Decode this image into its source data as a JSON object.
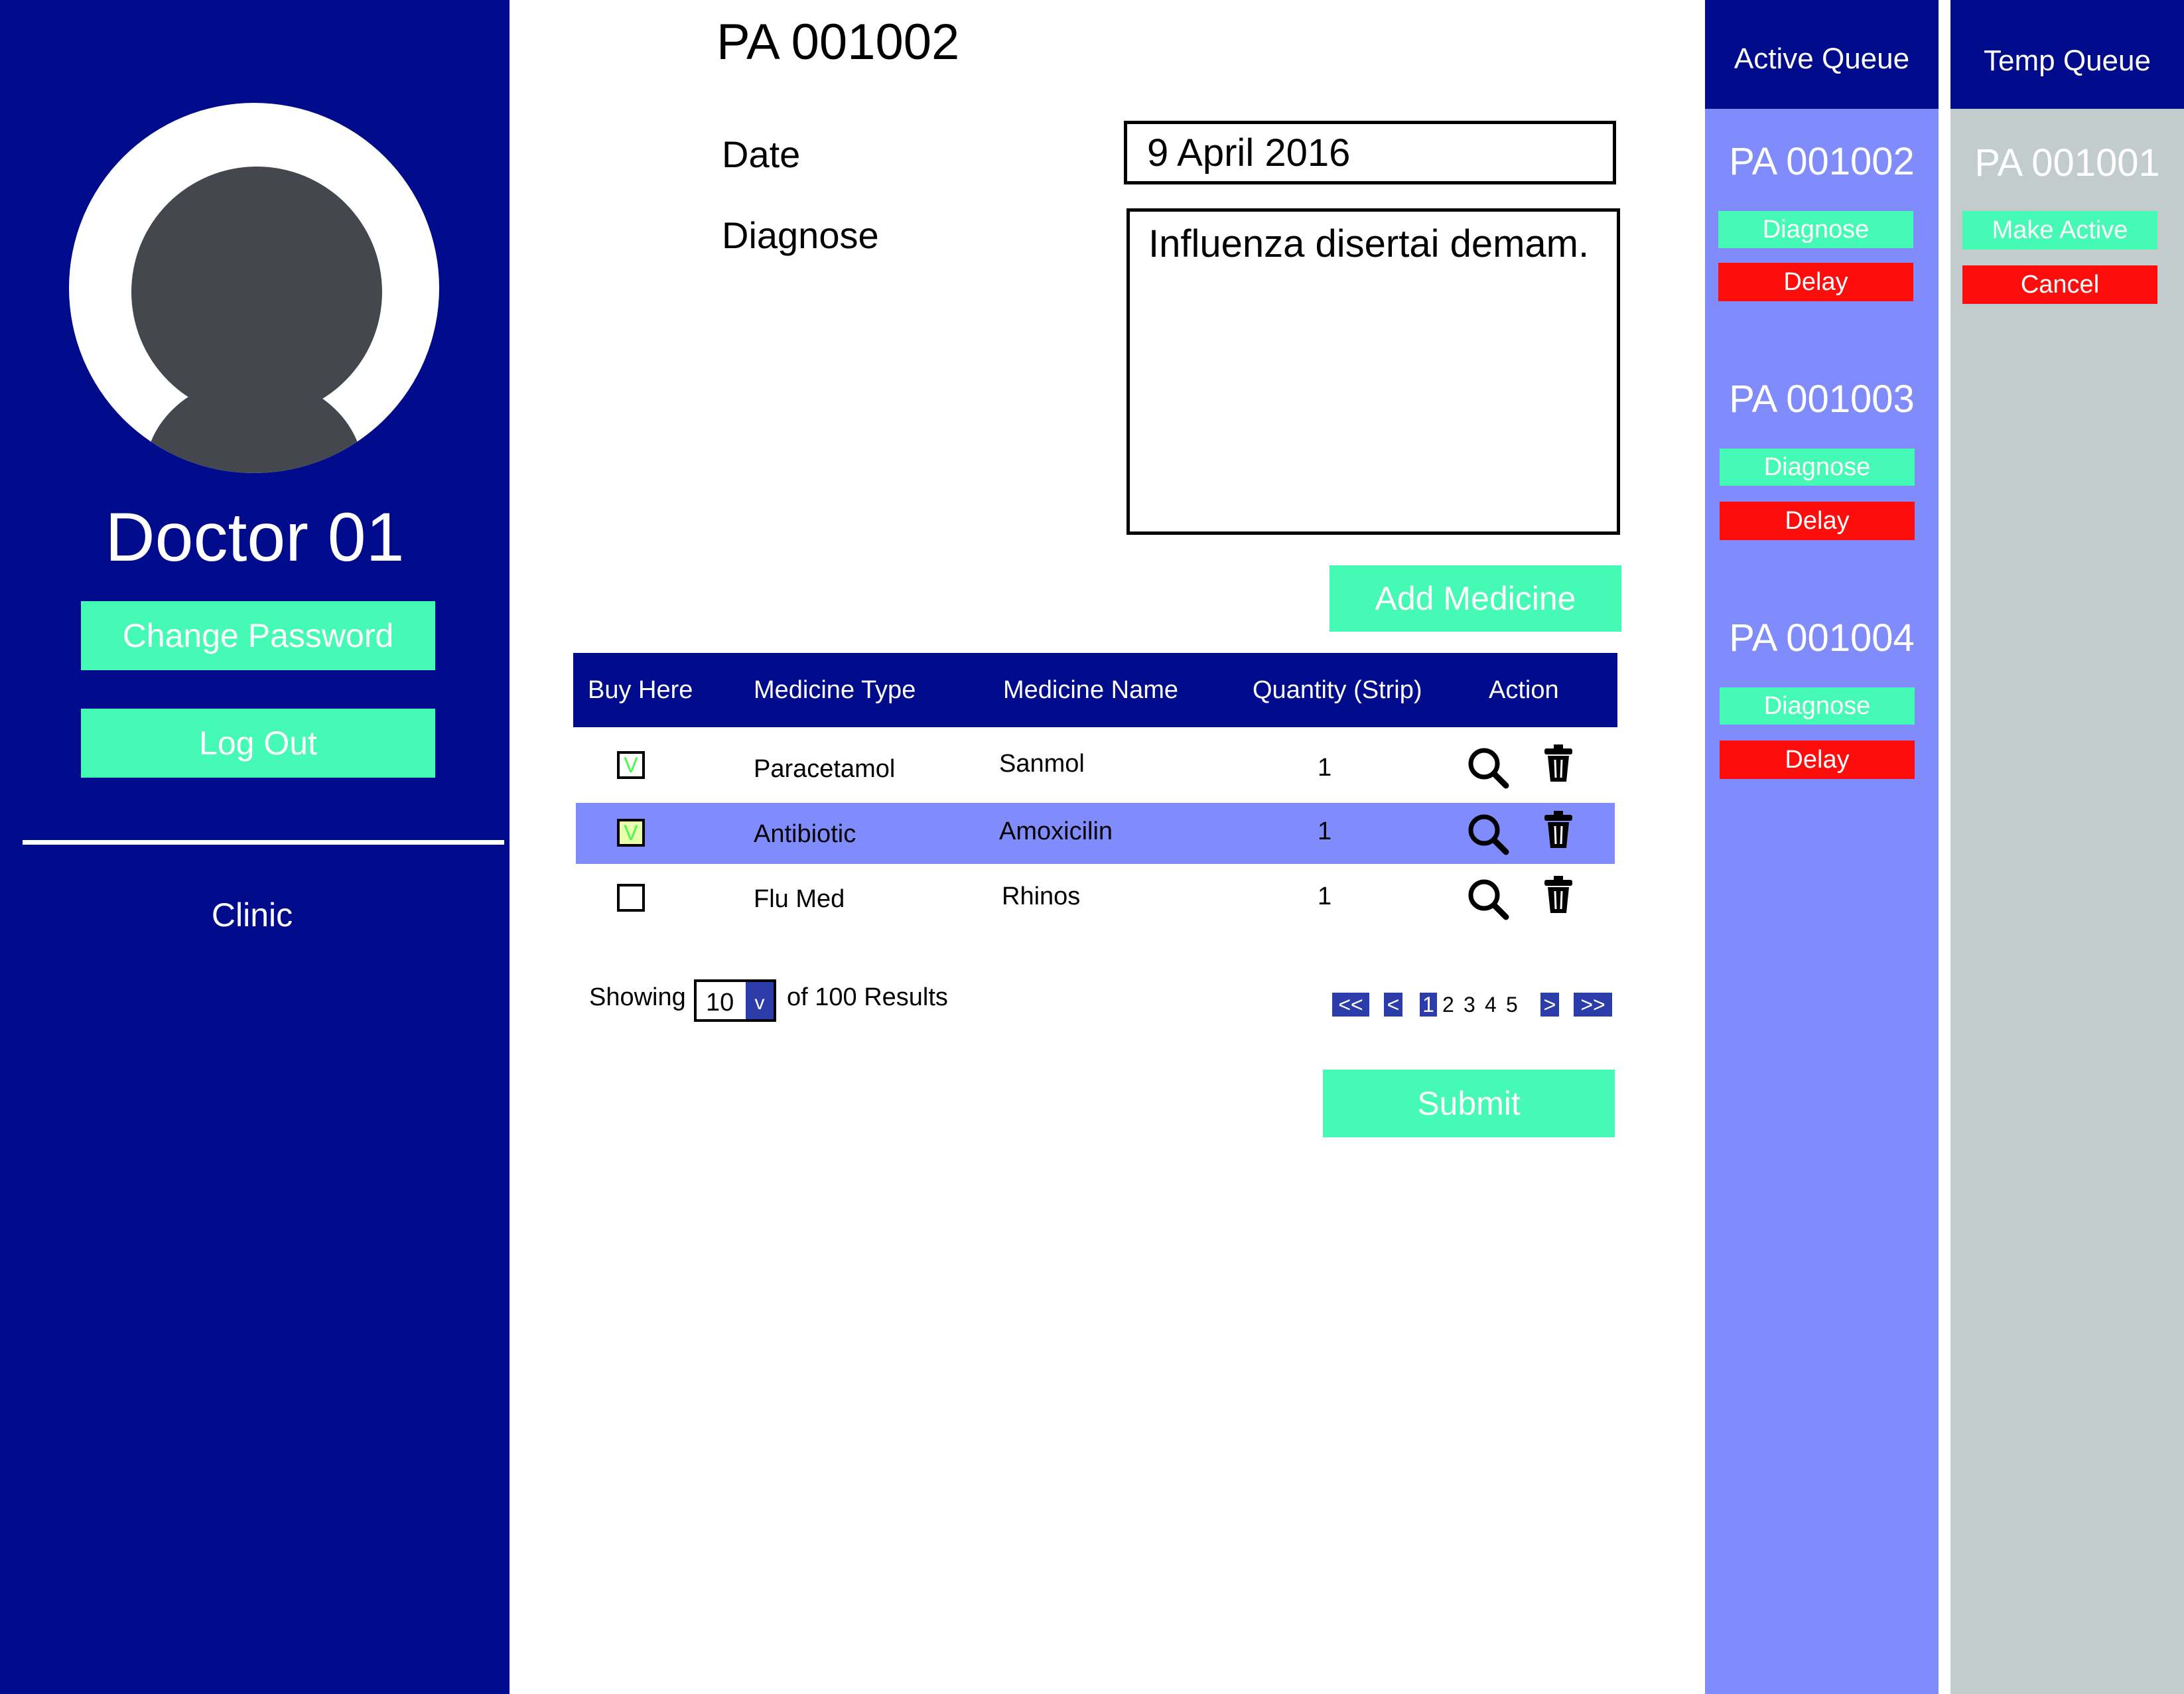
{
  "sidebar": {
    "doctor_name": "Doctor 01",
    "change_password_label": "Change Password",
    "logout_label": "Log Out",
    "nav_clinic": "Clinic"
  },
  "main": {
    "patient_id": "PA 001002",
    "date_label": "Date",
    "date_value": "9 April 2016",
    "diagnose_label": "Diagnose",
    "diagnose_value": "Influenza disertai demam.",
    "add_medicine_label": "Add Medicine",
    "submit_label": "Submit"
  },
  "table": {
    "headers": [
      "Buy Here",
      "Medicine Type",
      "Medicine Name",
      "Quantity (Strip)",
      "Action"
    ],
    "rows": [
      {
        "buy_here": true,
        "check_mark": "V",
        "medicine_type": "Paracetamol",
        "medicine_name": "Sanmol",
        "quantity": "1",
        "selected": false
      },
      {
        "buy_here": true,
        "check_mark": "V",
        "medicine_type": "Antibiotic",
        "medicine_name": "Amoxicilin",
        "quantity": "1",
        "selected": true
      },
      {
        "buy_here": false,
        "check_mark": "",
        "medicine_type": "Flu Med",
        "medicine_name": "Rhinos",
        "quantity": "1",
        "selected": false
      }
    ],
    "action_icons": [
      "magnifier-icon",
      "trash-icon"
    ]
  },
  "pagination": {
    "showing_label": "Showing",
    "page_size": "10",
    "dropdown_glyph": "v",
    "results_label": "of 100 Results",
    "first": "<<",
    "prev": "<",
    "pages": [
      "1",
      "2",
      "3",
      "4",
      "5"
    ],
    "current_page": "1",
    "next": ">",
    "last": ">>"
  },
  "active_queue": {
    "title": "Active Queue",
    "items": [
      {
        "id": "PA 001002",
        "primary_label": "Diagnose",
        "secondary_label": "Delay"
      },
      {
        "id": "PA 001003",
        "primary_label": "Diagnose",
        "secondary_label": "Delay"
      },
      {
        "id": "PA 001004",
        "primary_label": "Diagnose",
        "secondary_label": "Delay"
      }
    ]
  },
  "temp_queue": {
    "title": "Temp Queue",
    "items": [
      {
        "id": "PA 001001",
        "primary_label": "Make Active",
        "secondary_label": "Cancel"
      }
    ]
  },
  "colors": {
    "navy": "#000c8c",
    "periwinkle": "#808cfc",
    "mint": "#45fab4",
    "red": "#ff0c0c",
    "grey_panel": "#c2cccc",
    "avatar_grey": "#44484e"
  }
}
